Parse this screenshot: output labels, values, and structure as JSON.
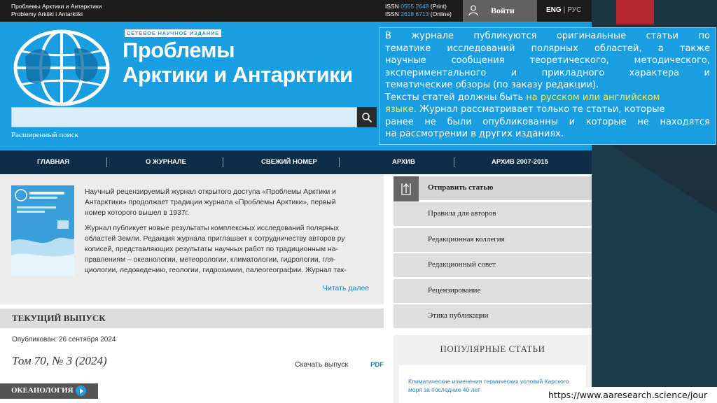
{
  "colors": {
    "brand_blue": "#1a9ee2",
    "nav_dark": "#0f2d47",
    "link": "#1d7fc4",
    "highlight": "#f5e94a"
  },
  "topbar": {
    "journal_ru": "Проблемы Арктики и Антарктики",
    "journal_en": "Problemy Arktiki i Antarktiki",
    "issn_print_label": "ISSN",
    "issn_print_num": "0555 2648",
    "issn_print_type": "(Print)",
    "issn_online_label": "ISSN",
    "issn_online_num": "2618 6713",
    "issn_online_type": "(Online)",
    "login_label": "Войти",
    "lang_en": "ENG",
    "lang_sep": "|",
    "lang_ru": "РУС",
    "user_icon": "user-icon"
  },
  "header": {
    "tagline": "СЕТЕВОЕ НАУЧНОЕ ИЗДАНИЕ",
    "title_line1": "Проблемы",
    "title_line2": "Арктики и Антарктики",
    "search_placeholder": "",
    "search_icon": "search-icon",
    "advanced_search": "Расширенный поиск"
  },
  "nav": {
    "items": [
      "ГЛАВНАЯ",
      "О ЖУРНАЛЕ",
      "СВЕЖИЙ НОМЕР",
      "АРХИВ",
      "АРХИВ 2007-2015"
    ]
  },
  "about": {
    "p1_l1": "Научный рецензируемый журнал открытого доступа «Проблемы Арктики и",
    "p1_l2": "Антарктики» продолжает традиции журнала «Проблемы Арктики», первый",
    "p1_l3": "номер которого вышел в 1937г.",
    "p2_l1": "Журнал публикует новые результаты комплексных исследований полярных",
    "p2_l2": "областей Земли. Редакция журнала приглашает к сотрудничеству авторов ру",
    "p2_l3": "кописей, представляющих  результаты научных работ по традиционным на-",
    "p2_l4": "правлениям – океанологии, метеорологии, климатологии, гидрологии, гля-",
    "p2_l5": "циологии, ледоведению, геологии, гидрохимии, палеогеографии. Журнал так-",
    "read_more": "Читать далее"
  },
  "current_issue": {
    "heading": "ТЕКУЩИЙ ВЫПУСК",
    "published": "Опубликован: 26 сентября 2024",
    "volume": "Том 70, № 3 (2024)",
    "download": "Скачать выпуск",
    "pdf": "PDF",
    "section": "ОКЕАНОЛОГИЯ"
  },
  "sidebar": {
    "items": [
      "Отправить статью",
      "Правила для авторов",
      "Редакционная коллегия",
      "Редакционный совет",
      "Рецензирование",
      "Этика публикации"
    ],
    "popular_heading": "ПОПУЛЯРНЫЕ СТАТЬИ",
    "popular_link": "Климатические изменения термических условий Карского моря за последние 40 лет"
  },
  "overlay": {
    "l1": "В журнале публикуются оригинальные статьи по",
    "l2": "тематике исследований полярных областей, а также",
    "l3": "научные сообщения теоретического, методического,",
    "l4": "экспериментального и прикладного характера и",
    "l5": "тематические обзоры (по заказу редакции).",
    "l6a": "Тексты статей должны быть ",
    "l6b": "на русском или английском",
    "l7a": "языке.",
    "l7b": " Журнал рассматривает только те статьи, которые",
    "l8": "ранее не были опубликованны и которые не находятся",
    "l9": "на рассмотрении в других изданиях."
  },
  "footer_url": "https://www.aaresearch.science/jour"
}
